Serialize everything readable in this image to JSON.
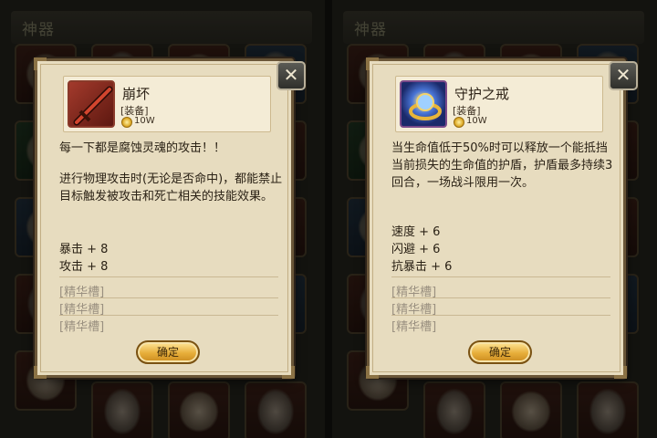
{
  "left_panel": {
    "section_title": "神器",
    "close_label": "✕",
    "item": {
      "name": "崩坏",
      "type": "[装备]",
      "price": "10W",
      "icon": "red-sword-icon",
      "description": [
        "每一下都是腐蚀灵魂的攻击！！",
        "进行物理攻击时(无论是否命中)，都能禁止目标触发被攻击和死亡相关的技能效果。"
      ],
      "stats": [
        "暴击 + 8",
        "攻击 + 8"
      ],
      "slots": [
        "[精华槽]",
        "[精华槽]",
        "[精华槽]"
      ]
    },
    "confirm_label": "确定"
  },
  "right_panel": {
    "section_title": "神器",
    "close_label": "✕",
    "item": {
      "name": "守护之戒",
      "type": "[装备]",
      "price": "10W",
      "icon": "gold-ring-icon",
      "description": [
        "当生命值低于50%时可以释放一个能抵挡当前损失的生命值的护盾，护盾最多持续3回合，一场战斗限用一次。"
      ],
      "stats": [
        "速度 + 6",
        "闪避 + 6",
        "抗暴击 + 6"
      ],
      "slots": [
        "[精华槽]",
        "[精华槽]",
        "[精华槽]"
      ]
    },
    "confirm_label": "确定"
  },
  "colors": {
    "dialog_bg": "#e7dcbf",
    "confirm_button": "#e7ae3a",
    "background": "#23231d"
  }
}
